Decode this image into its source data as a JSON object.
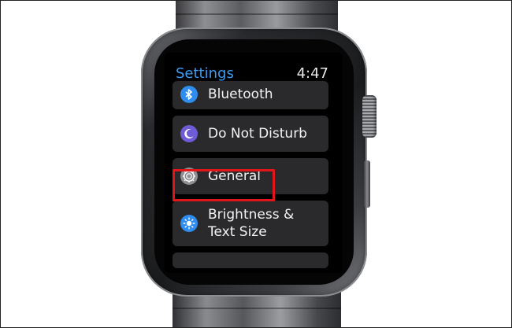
{
  "header": {
    "title": "Settings",
    "time": "4:47"
  },
  "list": {
    "items": [
      {
        "label": "Bluetooth",
        "icon": "bluetooth-icon"
      },
      {
        "label": "Do Not Disturb",
        "icon": "moon-icon"
      },
      {
        "label": "General",
        "icon": "gear-icon"
      },
      {
        "label": "Brightness &",
        "label2": "Text Size",
        "icon": "sun-icon"
      }
    ]
  },
  "colors": {
    "accent": "#3b9cf2",
    "row_background": "#2a2a2c",
    "highlight": "#e0161a"
  }
}
